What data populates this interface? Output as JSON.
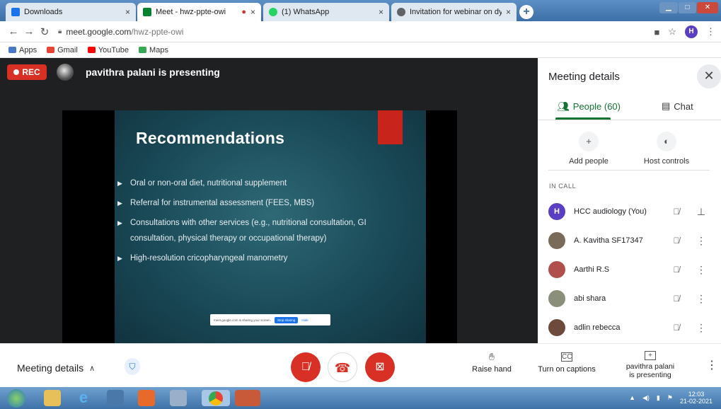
{
  "browser": {
    "tabs": [
      {
        "label": "Downloads",
        "icon": "download-icon",
        "color": "#1a73e8"
      },
      {
        "label": "Meet - hwz-ppte-owi",
        "icon": "meet-icon",
        "color": "#00832d"
      },
      {
        "label": "(1) WhatsApp",
        "icon": "whatsapp-icon",
        "color": "#25d366"
      },
      {
        "label": "Invitation for webinar on dyspha",
        "icon": "globe-icon",
        "color": "#5f6368"
      }
    ],
    "new_tab": "+",
    "url_host": "meet.google.com",
    "url_path": "/hwz-ppte-owi",
    "profile_initial": "H",
    "bookmarks": [
      "Apps",
      "Gmail",
      "YouTube",
      "Maps"
    ]
  },
  "stage": {
    "rec_label": "REC",
    "presenter_text": "pavithra palani is presenting",
    "slide": {
      "title": "Recommendations",
      "bullets": [
        "Oral or non-oral diet, nutritional supplement",
        "Referral for  instrumental assessment (FEES, MBS)",
        "Consultations with other services (e.g., nutritional consultation, GI",
        "consultation, physical therapy or occupational therapy)",
        "High-resolution cricopharyngeal manometry"
      ],
      "share_text": "meet.google.com is sharing your screen.",
      "share_stop": "Stop sharing",
      "share_hide": "Hide"
    }
  },
  "panel": {
    "title": "Meeting details",
    "tab_people": "People (60)",
    "tab_chat": "Chat",
    "add_people": "Add people",
    "host_controls": "Host controls",
    "section_label": "IN CALL",
    "people": [
      {
        "name": "HCC audiology (You)",
        "initial": "H",
        "color": "#5b3fc2"
      },
      {
        "name": "A. Kavitha SF17347",
        "initial": "",
        "color": "#7a6a5a"
      },
      {
        "name": "Aarthi R.S",
        "initial": "",
        "color": "#b0504a"
      },
      {
        "name": "abi shara",
        "initial": "",
        "color": "#8a8f7a"
      },
      {
        "name": "adlin rebecca",
        "initial": "",
        "color": "#6e4a3c"
      }
    ]
  },
  "bottom": {
    "meeting_details": "Meeting details",
    "raise_hand": "Raise hand",
    "captions": "Turn on captions",
    "presenting_line1": "pavithra palani",
    "presenting_line2": "is presenting",
    "colors": {
      "end_call": "#ea4335",
      "muted": "#d93025"
    }
  },
  "taskbar": {
    "time": "12:03",
    "date": "21-02-2021"
  }
}
